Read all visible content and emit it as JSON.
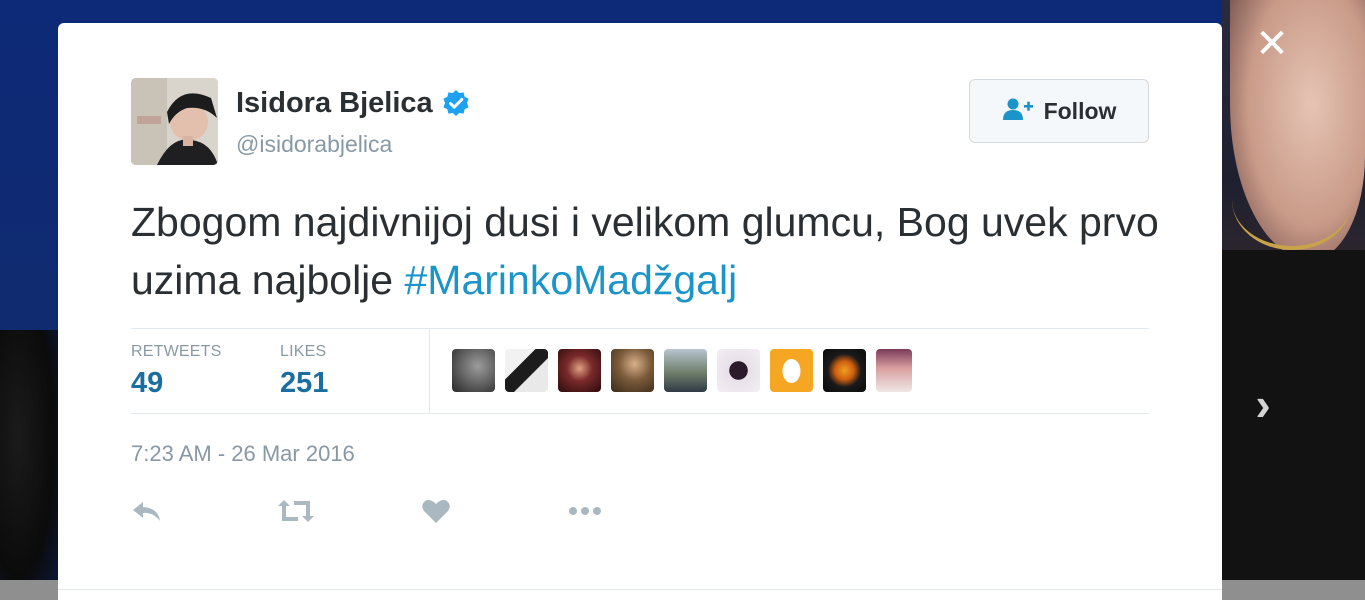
{
  "colors": {
    "link": "#1b95c9",
    "stat_value": "#1b6fa0",
    "muted": "#8899a6",
    "text": "#292f33",
    "verified": "#1da1f2"
  },
  "modal": {
    "close_icon": "close-icon",
    "next_icon": "chevron-right-icon"
  },
  "tweet": {
    "author": {
      "name": "Isidora Bjelica",
      "handle": "@isidorabjelica",
      "verified": true
    },
    "follow_label": "Follow",
    "text": "Zbogom najdivnijoj dusi i velikom glumcu, Bog uvek prvo uzima najbolje ",
    "hashtag": "#MarinkoMadžgalj",
    "stats": {
      "retweets_label": "RETWEETS",
      "retweets": "49",
      "likes_label": "LIKES",
      "likes": "251"
    },
    "likers_count_shown": 9,
    "timestamp": "7:23 AM - 26 Mar 2016",
    "actions": [
      "reply-icon",
      "retweet-icon",
      "like-icon",
      "more-icon"
    ]
  }
}
